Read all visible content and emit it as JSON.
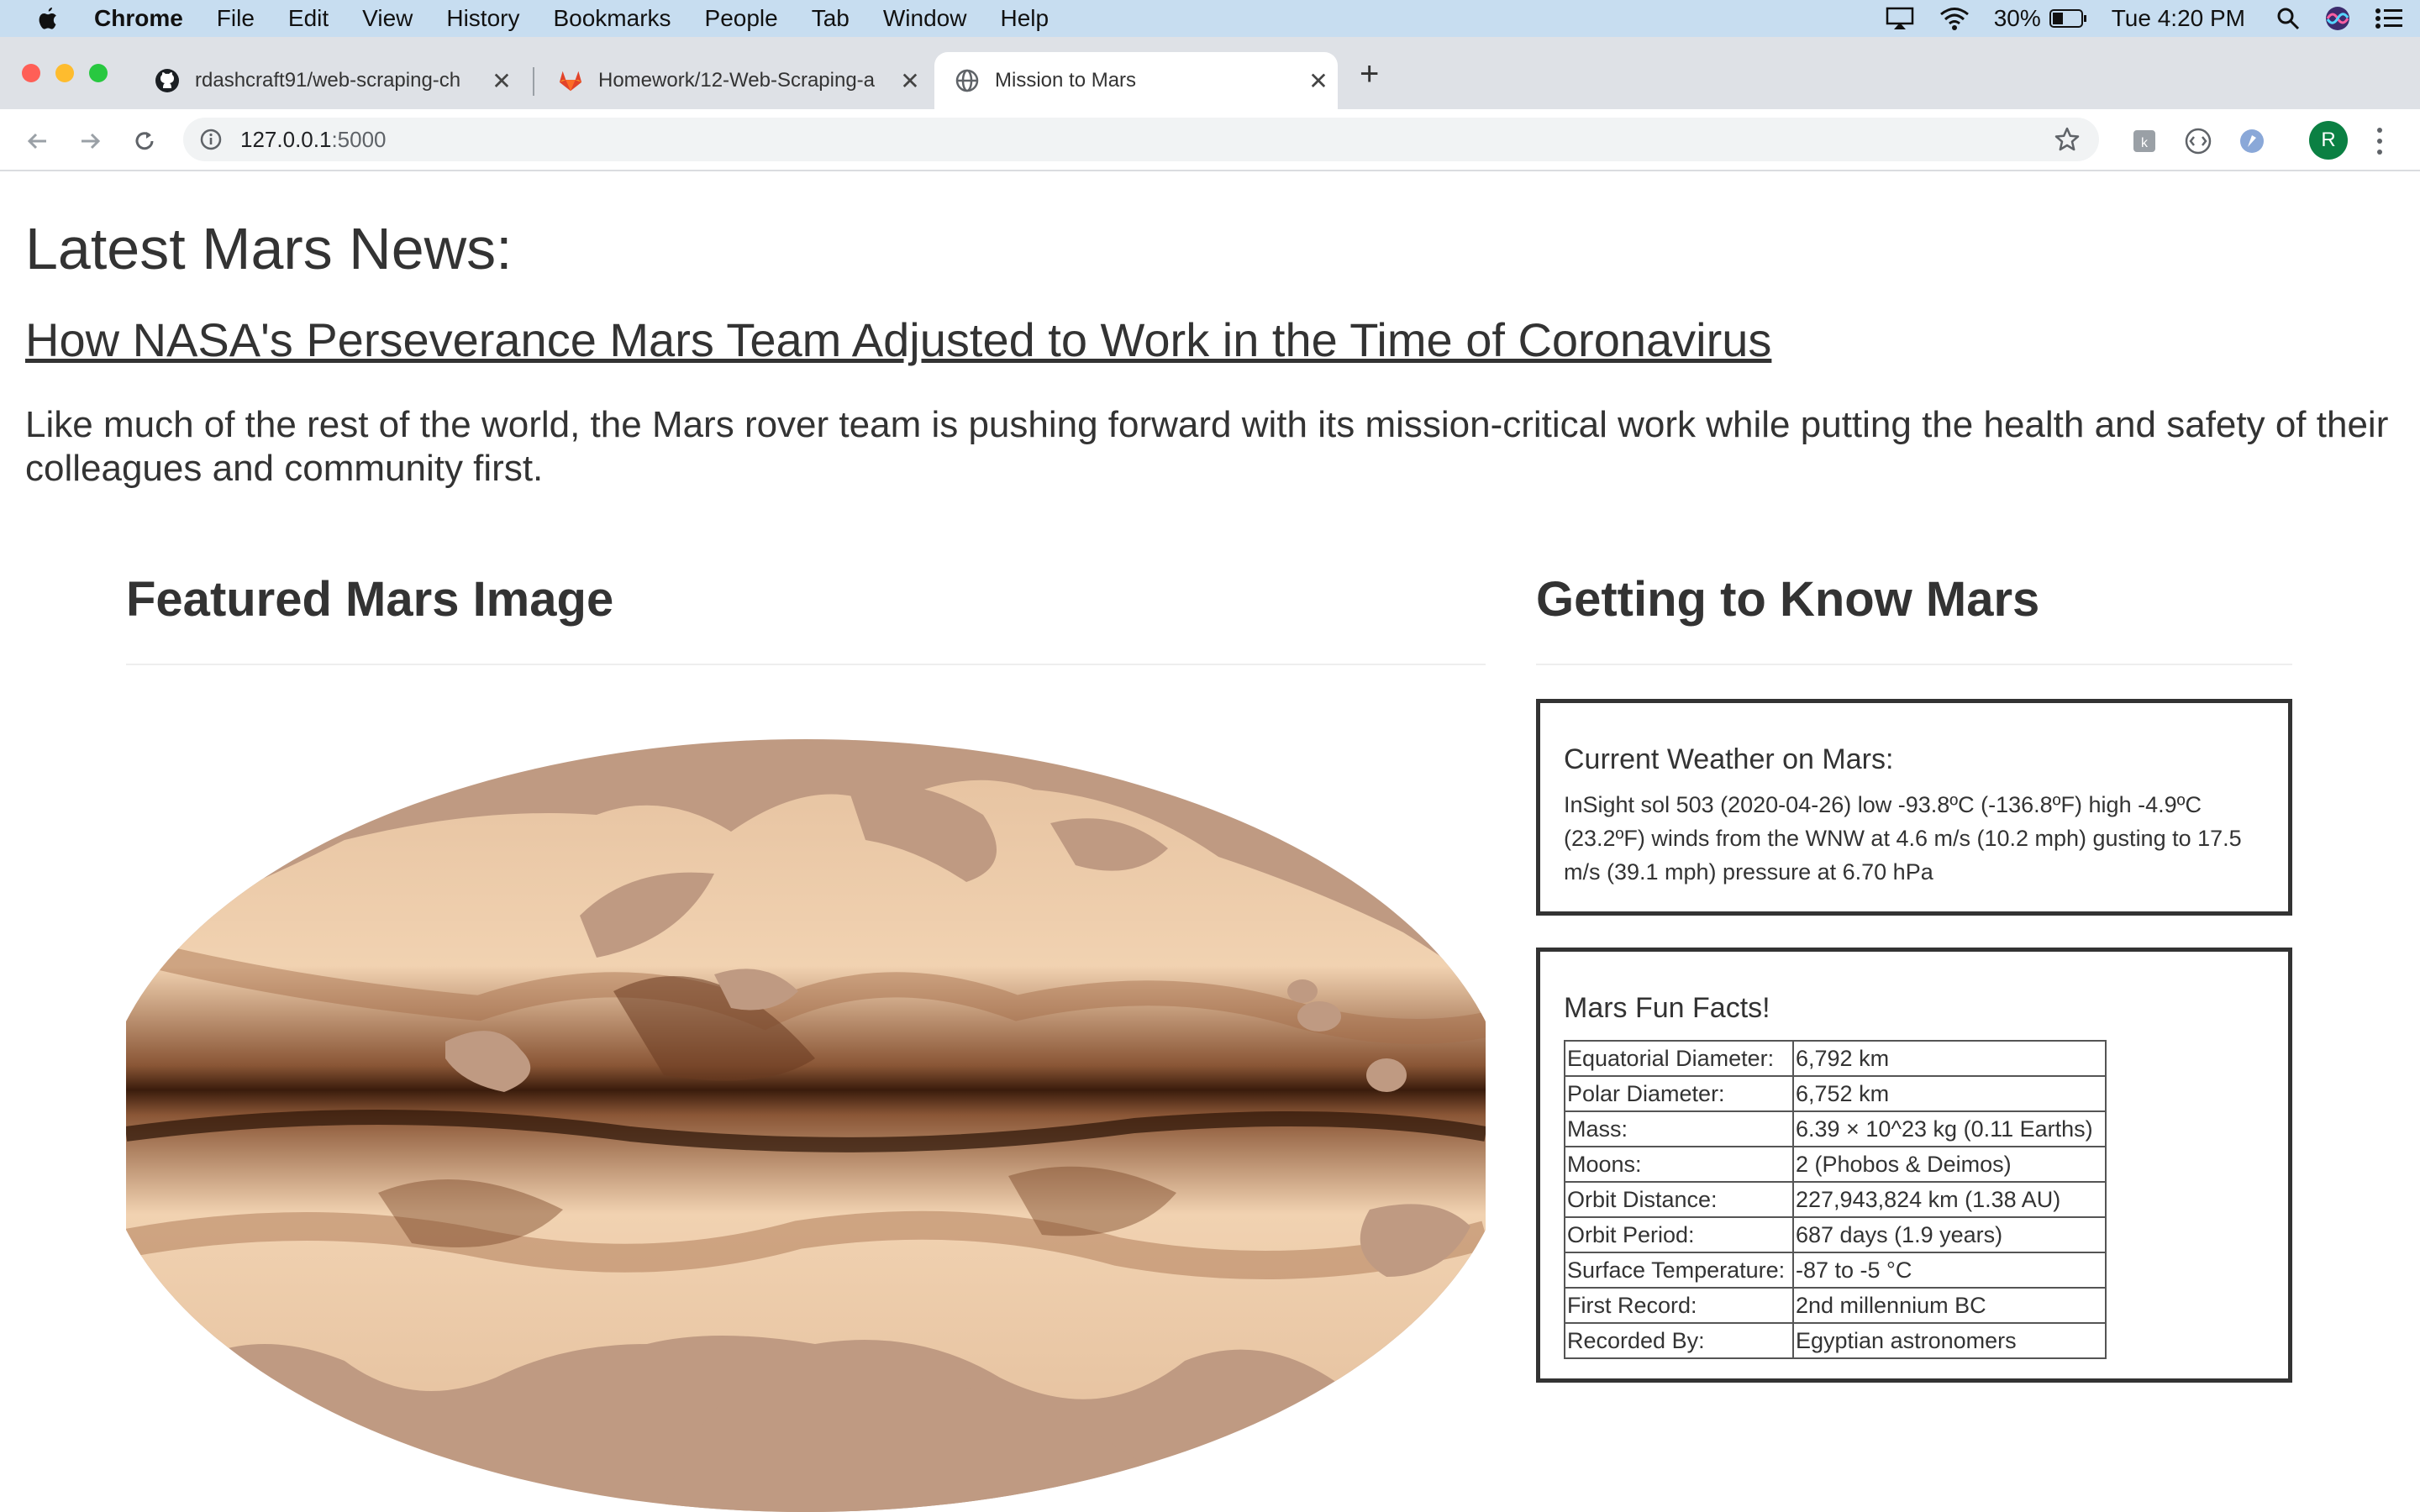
{
  "menubar": {
    "app": "Chrome",
    "items": [
      "File",
      "Edit",
      "View",
      "History",
      "Bookmarks",
      "People",
      "Tab",
      "Window",
      "Help"
    ],
    "battery": "30%",
    "clock": "Tue 4:20 PM"
  },
  "tabs": [
    {
      "title": "rdashcraft91/web-scraping-ch",
      "icon": "github-icon"
    },
    {
      "title": "Homework/12-Web-Scraping-a",
      "icon": "gitlab-icon"
    },
    {
      "title": "Mission to Mars",
      "icon": "globe-icon"
    }
  ],
  "toolbar": {
    "url_host": "127.0.0.1",
    "url_port": ":5000",
    "profile_initial": "R"
  },
  "page": {
    "news_heading": "Latest Mars News:",
    "news_title": "How NASA's Perseverance Mars Team Adjusted to Work in the Time of Coronavirus",
    "news_teaser": "Like much of the rest of the world, the Mars rover team is pushing forward with its mission-critical work while putting the health and safety of their colleagues and community first.",
    "featured_heading": "Featured Mars Image",
    "know_heading": "Getting to Know Mars",
    "weather_heading": "Current Weather on Mars:",
    "weather_text": "InSight sol 503 (2020-04-26) low -93.8ºC (-136.8ºF) high -4.9ºC (23.2ºF) winds from the WNW at 4.6 m/s (10.2 mph) gusting to 17.5 m/s (39.1 mph) pressure at 6.70 hPa",
    "facts_heading": "Mars Fun Facts!",
    "facts": [
      {
        "k": "Equatorial Diameter:",
        "v": "6,792 km"
      },
      {
        "k": "Polar Diameter:",
        "v": "6,752 km"
      },
      {
        "k": "Mass:",
        "v": "6.39 × 10^23 kg (0.11 Earths)"
      },
      {
        "k": "Moons:",
        "v": "2 (Phobos & Deimos)"
      },
      {
        "k": "Orbit Distance:",
        "v": "227,943,824 km (1.38 AU)"
      },
      {
        "k": "Orbit Period:",
        "v": "687 days (1.9 years)"
      },
      {
        "k": "Surface Temperature:",
        "v": "-87 to -5 °C"
      },
      {
        "k": "First Record:",
        "v": "2nd millennium BC"
      },
      {
        "k": "Recorded By:",
        "v": "Egyptian astronomers"
      }
    ]
  },
  "colors": {
    "menubar_bg": "#c7ddf0",
    "tabstrip_bg": "#dee1e6",
    "text": "#333333",
    "panel_border": "#333333",
    "image_base": "#bf9a82",
    "image_dark": "#3a1c0c",
    "image_light": "#f8e3c6"
  }
}
